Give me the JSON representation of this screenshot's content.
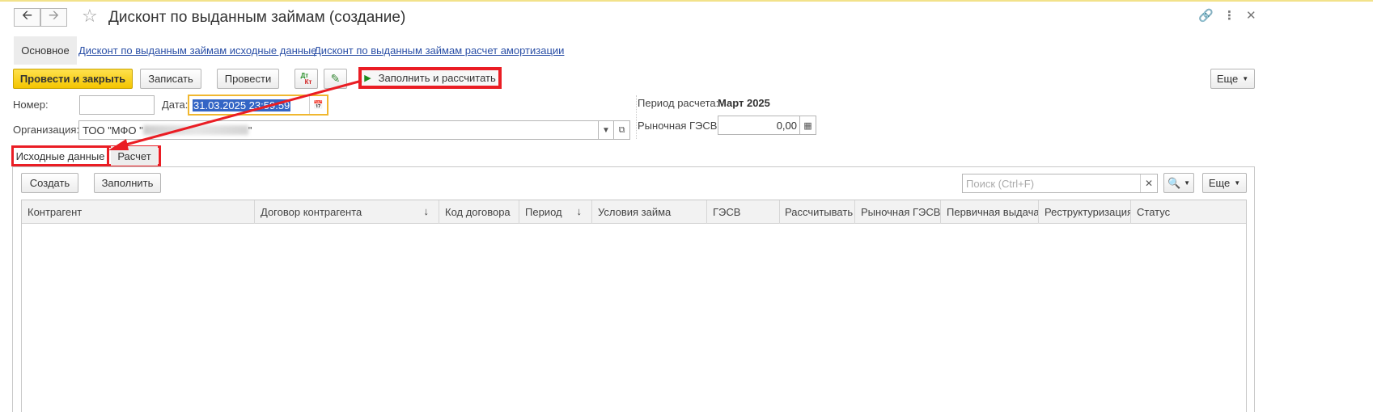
{
  "window": {
    "title": "Дисконт по выданным займам (создание)",
    "back_icon": "arrow-left-icon",
    "forward_icon": "arrow-right-icon",
    "star_icon": "star-icon",
    "link_icon": "link-icon",
    "more_icon": "more-vertical-icon",
    "close_icon": "close-icon"
  },
  "sections": {
    "main": "Основное",
    "links": [
      "Дисконт по выданным займам исходные данные",
      "Дисконт по выданным займам расчет амортизации"
    ]
  },
  "toolbar": {
    "post_close": "Провести и закрыть",
    "save": "Записать",
    "post": "Провести",
    "dtkt_icon": "dt-kt-icon",
    "edit_icon": "pencil-icon",
    "fill_calc": "Заполнить и рассчитать",
    "more": "Еще"
  },
  "form": {
    "number_label": "Номер:",
    "number_value": "",
    "date_label": "Дата:",
    "date_value": "31.03.2025 23:59:59",
    "org_label": "Организация:",
    "org_value_prefix": "ТОО \"МФО \"",
    "org_value_suffix": "\"",
    "period_label": "Период расчета:",
    "period_value": "Март 2025",
    "gesv_label": "Рыночная ГЭСВ:",
    "gesv_value": "0,00"
  },
  "tabs": {
    "source": "Исходные данные",
    "calc": "Расчет"
  },
  "table_toolbar": {
    "create": "Создать",
    "fill": "Заполнить",
    "search_placeholder": "Поиск (Ctrl+F)",
    "more": "Еще"
  },
  "table": {
    "columns": [
      "Контрагент",
      "Договор контрагента",
      "Код договора",
      "Период",
      "Условия займа",
      "ГЭСВ",
      "Рассчитывать",
      "Рыночная ГЭСВ",
      "Первичная выдача",
      "Реструктуризация",
      "Статус"
    ],
    "rows": []
  },
  "colors": {
    "accent_yellow": "#f4c500",
    "highlight_red": "#ea1d24",
    "link_blue": "#2a4fa6",
    "focus_border": "#f0b72f"
  }
}
